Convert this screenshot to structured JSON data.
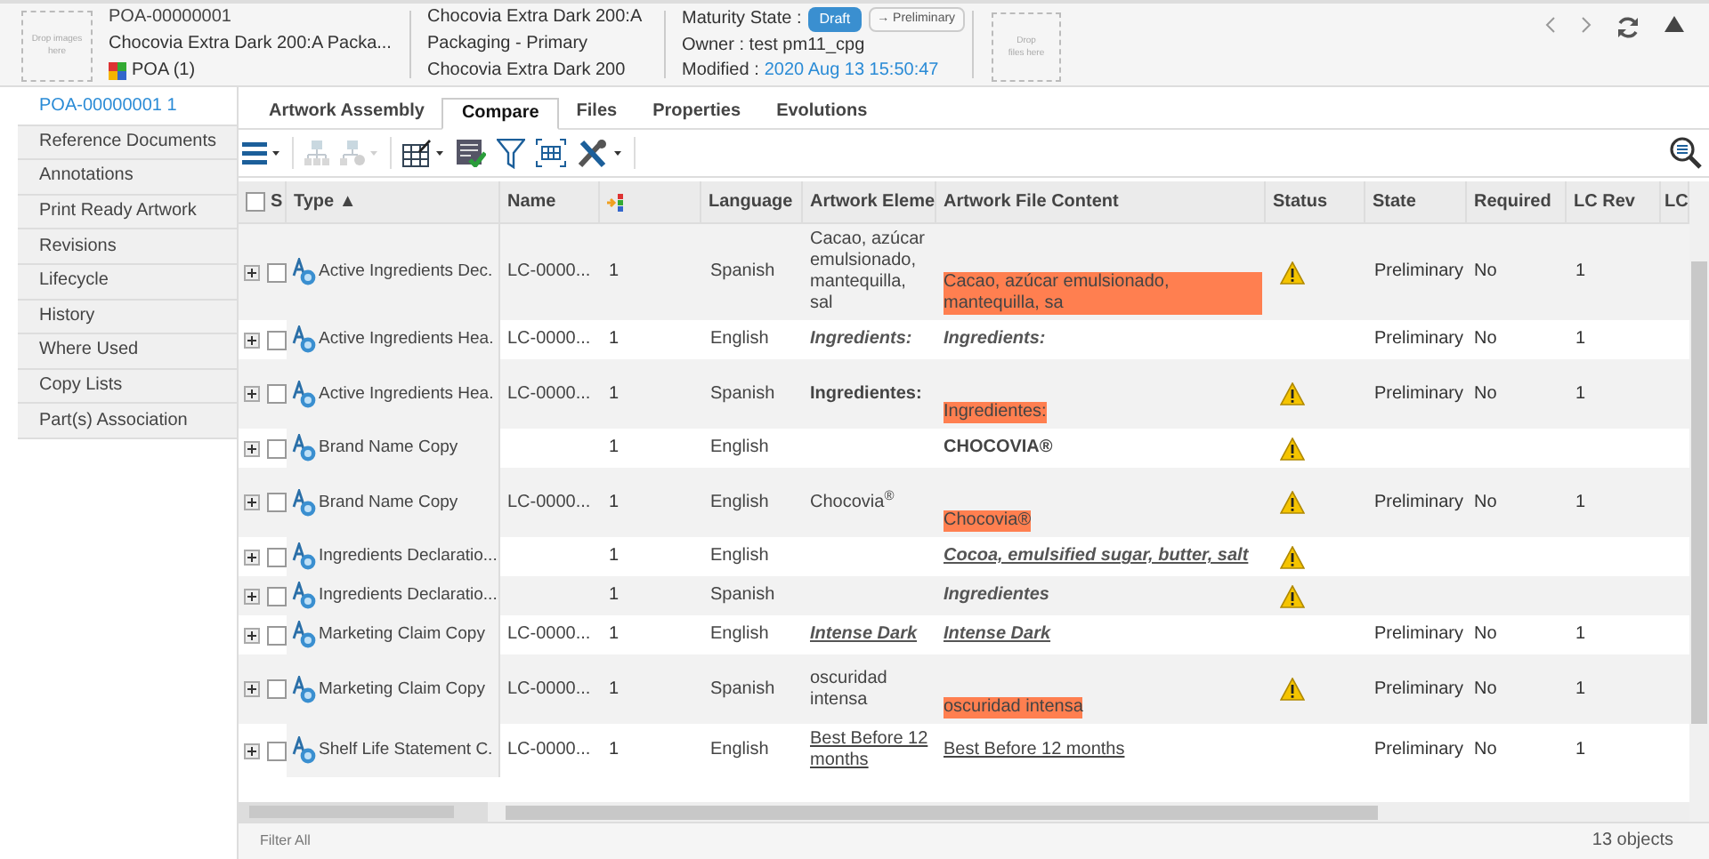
{
  "header": {
    "image_drop": "Drop images here",
    "id": "POA-00000001",
    "title": "Chocovia Extra Dark 200:A Packa...",
    "poa": "POA (1)",
    "details": [
      "Chocovia Extra Dark 200:A",
      "Packaging - Primary",
      "Chocovia Extra Dark 200"
    ],
    "maturity_label": "Maturity State :",
    "maturity_badge": "Draft",
    "promote_button": "→ Preliminary",
    "owner": "Owner : test pm11_cpg",
    "modified_label": "Modified :",
    "modified_value": "2020 Aug 13 15:50:47",
    "file_drop": "Drop files here"
  },
  "sidebar": {
    "items": [
      {
        "label": "POA-00000001 1",
        "selected": true
      },
      {
        "label": "Reference Documents",
        "selected": false
      },
      {
        "label": "Annotations",
        "selected": false
      },
      {
        "label": "Print Ready Artwork",
        "selected": false
      },
      {
        "label": "Revisions",
        "selected": false
      },
      {
        "label": "Lifecycle",
        "selected": false
      },
      {
        "label": "History",
        "selected": false
      },
      {
        "label": "Where Used",
        "selected": false
      },
      {
        "label": "Copy Lists",
        "selected": false
      },
      {
        "label": "Part(s) Association",
        "selected": false
      }
    ]
  },
  "tabs": [
    {
      "label": "Artwork Assembly",
      "selected": false
    },
    {
      "label": "Compare",
      "selected": true
    },
    {
      "label": "Files",
      "selected": false
    },
    {
      "label": "Properties",
      "selected": false
    },
    {
      "label": "Evolutions",
      "selected": false
    }
  ],
  "table": {
    "select_all_checked": false,
    "columns": [
      "S",
      "Type ▲",
      "Name",
      "",
      "Language",
      "Artwork Eleme",
      "Artwork File Content",
      "Status",
      "State",
      "Required",
      "LC Rev",
      "LC"
    ],
    "rows": [
      {
        "type": "Active Ingredients Dec.",
        "name": "LC-0000...",
        "col_3": "1",
        "language": "Spanish",
        "element": {
          "text": "Cacao, azúcar emulsionado, mantequilla, sal",
          "kind": "plain"
        },
        "content": {
          "text": "Cacao, azúcar emulsionado, mantequilla, sa",
          "kind": "plain",
          "changed": true
        },
        "warning": true,
        "state": "Preliminary",
        "required": "No",
        "lc_rev": "1",
        "checked": false
      },
      {
        "type": "Active Ingredients Hea.",
        "name": "LC-0000...",
        "col_3": "1",
        "language": "English",
        "element": {
          "text": "Ingredients:",
          "kind": "emphasis"
        },
        "content": {
          "text": "Ingredients:",
          "kind": "emphasis",
          "changed": false
        },
        "warning": false,
        "state": "Preliminary",
        "required": "No",
        "lc_rev": "1",
        "checked": false
      },
      {
        "type": "Active Ingredients Hea.",
        "name": "LC-0000...",
        "col_3": "1",
        "language": "Spanish",
        "element": {
          "text": "Ingredientes:",
          "kind": "strong"
        },
        "content": {
          "text": "Ingredientes:",
          "kind": "plain",
          "changed": true
        },
        "warning": true,
        "state": "Preliminary",
        "required": "No",
        "lc_rev": "1",
        "checked": false
      },
      {
        "type": "Brand Name Copy",
        "col_3": "1",
        "language": "English",
        "content": {
          "text": "CHOCOVIA®",
          "kind": "strong",
          "changed": false
        },
        "warning": true,
        "checked": false
      },
      {
        "type": "Brand Name Copy",
        "name": "LC-0000...",
        "col_3": "1",
        "language": "English",
        "element": {
          "text": "Chocovia$^{®}$",
          "kind": "plain"
        },
        "content": {
          "text": "Chocovia®",
          "kind": "plain",
          "changed": true
        },
        "warning": true,
        "state": "Preliminary",
        "required": "No",
        "lc_rev": "1",
        "checked": false
      },
      {
        "type": "Ingredients Declaratio...",
        "col_3": "1",
        "language": "English",
        "content": {
          "text": "Cocoa, emulsified sugar, butter, salt",
          "kind": "emphasis-underlined",
          "changed": false
        },
        "warning": true,
        "checked": false
      },
      {
        "type": "Ingredients Declaratio...",
        "col_3": "1",
        "language": "Spanish",
        "content": {
          "text": "Ingredientes",
          "kind": "emphasis",
          "changed": false
        },
        "warning": true,
        "checked": false
      },
      {
        "type": "Marketing Claim Copy",
        "name": "LC-0000...",
        "col_3": "1",
        "language": "English",
        "element": {
          "text": "Intense Dark",
          "kind": "emphasis-underlined"
        },
        "content": {
          "text": "Intense Dark",
          "kind": "emphasis-underlined",
          "changed": false
        },
        "warning": false,
        "state": "Preliminary",
        "required": "No",
        "lc_rev": "1",
        "checked": false
      },
      {
        "type": "Marketing Claim Copy",
        "name": "LC-0000...",
        "col_3": "1",
        "language": "Spanish",
        "element": {
          "text": "oscuridad intensa",
          "kind": "plain"
        },
        "content": {
          "text": "oscuridad intensa",
          "kind": "plain",
          "changed": true
        },
        "warning": true,
        "state": "Preliminary",
        "required": "No",
        "lc_rev": "1",
        "checked": false
      },
      {
        "type": "Shelf Life Statement C.",
        "name": "LC-0000...",
        "col_3": "1",
        "language": "English",
        "element": {
          "text": "Best Before 12 months",
          "kind": "underlined"
        },
        "content": {
          "text": "Best Before 12 months",
          "kind": "underlined",
          "changed": false
        },
        "warning": false,
        "state": "Preliminary",
        "required": "No",
        "lc_rev": "1",
        "checked": false
      }
    ]
  },
  "footer": {
    "filter": "Filter All",
    "count": "13 objects"
  }
}
